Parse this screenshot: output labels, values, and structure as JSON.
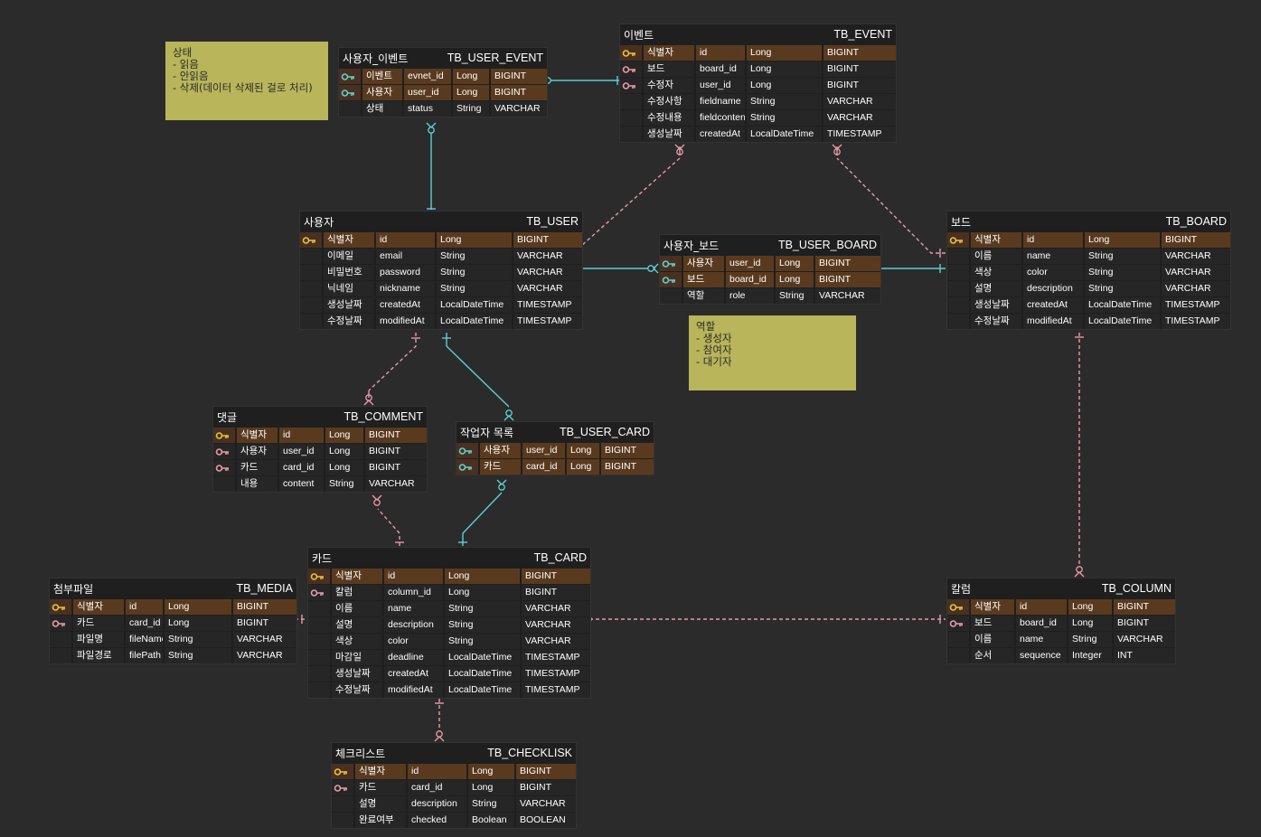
{
  "notes": {
    "status": [
      "상태",
      "- 읽음",
      "- 안읽음",
      "- 삭제(데이터 삭제된 걸로 처리)"
    ],
    "role": [
      "역할",
      "- 생성자",
      "- 참여자",
      "- 대기자"
    ]
  },
  "colors": {
    "pk": "#e8c23a",
    "fk_pink": "#e89aa8",
    "fk_teal": "#5fd0d0",
    "note": "#b8b55a",
    "pk_row": "#5a3a1e"
  },
  "entities": {
    "user_event": {
      "title": "사용자_이벤트",
      "table": "TB_USER_EVENT",
      "rows": [
        {
          "icon": "teal-key",
          "label": "이벤트",
          "name": "evnet_id",
          "java": "Long",
          "sql": "BIGINT",
          "pk": true
        },
        {
          "icon": "teal-key",
          "label": "사용자",
          "name": "user_id",
          "java": "Long",
          "sql": "BIGINT",
          "pk": true
        },
        {
          "icon": "",
          "label": "상태",
          "name": "status",
          "java": "String",
          "sql": "VARCHAR",
          "pk": false
        }
      ]
    },
    "event": {
      "title": "이벤트",
      "table": "TB_EVENT",
      "rows": [
        {
          "icon": "gold-key",
          "label": "식별자",
          "name": "id",
          "java": "Long",
          "sql": "BIGINT",
          "pk": true
        },
        {
          "icon": "pink-key",
          "label": "보드",
          "name": "board_id",
          "java": "Long",
          "sql": "BIGINT",
          "pk": false
        },
        {
          "icon": "pink-key",
          "label": "수정자",
          "name": "user_id",
          "java": "Long",
          "sql": "BIGINT",
          "pk": false
        },
        {
          "icon": "",
          "label": "수정사항",
          "name": "fieldname",
          "java": "String",
          "sql": "VARCHAR",
          "pk": false
        },
        {
          "icon": "",
          "label": "수정내용",
          "name": "fieldcontent",
          "java": "String",
          "sql": "VARCHAR",
          "pk": false
        },
        {
          "icon": "",
          "label": "생성날짜",
          "name": "createdAt",
          "java": "LocalDateTime",
          "sql": "TIMESTAMP",
          "pk": false
        }
      ]
    },
    "user": {
      "title": "사용자",
      "table": "TB_USER",
      "rows": [
        {
          "icon": "gold-key",
          "label": "식별자",
          "name": "id",
          "java": "Long",
          "sql": "BIGINT",
          "pk": true
        },
        {
          "icon": "",
          "label": "이메일",
          "name": "email",
          "java": "String",
          "sql": "VARCHAR",
          "pk": false
        },
        {
          "icon": "",
          "label": "비밀번호",
          "name": "password",
          "java": "String",
          "sql": "VARCHAR",
          "pk": false
        },
        {
          "icon": "",
          "label": "닉네임",
          "name": "nickname",
          "java": "String",
          "sql": "VARCHAR",
          "pk": false
        },
        {
          "icon": "",
          "label": "생성날짜",
          "name": "createdAt",
          "java": "LocalDateTime",
          "sql": "TIMESTAMP",
          "pk": false
        },
        {
          "icon": "",
          "label": "수정날짜",
          "name": "modifiedAt",
          "java": "LocalDateTime",
          "sql": "TIMESTAMP",
          "pk": false
        }
      ]
    },
    "user_board": {
      "title": "사용자_보드",
      "table": "TB_USER_BOARD",
      "rows": [
        {
          "icon": "teal-key",
          "label": "사용자",
          "name": "user_id",
          "java": "Long",
          "sql": "BIGINT",
          "pk": true
        },
        {
          "icon": "teal-key",
          "label": "보드",
          "name": "board_id",
          "java": "Long",
          "sql": "BIGINT",
          "pk": true
        },
        {
          "icon": "",
          "label": "역할",
          "name": "role",
          "java": "String",
          "sql": "VARCHAR",
          "pk": false
        }
      ]
    },
    "board": {
      "title": "보드",
      "table": "TB_BOARD",
      "rows": [
        {
          "icon": "gold-key",
          "label": "식별자",
          "name": "id",
          "java": "Long",
          "sql": "BIGINT",
          "pk": true
        },
        {
          "icon": "",
          "label": "이름",
          "name": "name",
          "java": "String",
          "sql": "VARCHAR",
          "pk": false
        },
        {
          "icon": "",
          "label": "색상",
          "name": "color",
          "java": "String",
          "sql": "VARCHAR",
          "pk": false
        },
        {
          "icon": "",
          "label": "설명",
          "name": "description",
          "java": "String",
          "sql": "VARCHAR",
          "pk": false
        },
        {
          "icon": "",
          "label": "생성날짜",
          "name": "createdAt",
          "java": "LocalDateTime",
          "sql": "TIMESTAMP",
          "pk": false
        },
        {
          "icon": "",
          "label": "수정날짜",
          "name": "modifiedAt",
          "java": "LocalDateTime",
          "sql": "TIMESTAMP",
          "pk": false
        }
      ]
    },
    "comment": {
      "title": "댓글",
      "table": "TB_COMMENT",
      "rows": [
        {
          "icon": "gold-key",
          "label": "식별자",
          "name": "id",
          "java": "Long",
          "sql": "BIGINT",
          "pk": true
        },
        {
          "icon": "pink-key",
          "label": "사용자",
          "name": "user_id",
          "java": "Long",
          "sql": "BIGINT",
          "pk": false
        },
        {
          "icon": "pink-key",
          "label": "카드",
          "name": "card_id",
          "java": "Long",
          "sql": "BIGINT",
          "pk": false
        },
        {
          "icon": "",
          "label": "내용",
          "name": "content",
          "java": "String",
          "sql": "VARCHAR",
          "pk": false
        }
      ]
    },
    "user_card": {
      "title": "작업자 목록",
      "table": "TB_USER_CARD",
      "rows": [
        {
          "icon": "teal-key",
          "label": "사용자",
          "name": "user_id",
          "java": "Long",
          "sql": "BIGINT",
          "pk": true
        },
        {
          "icon": "teal-key",
          "label": "카드",
          "name": "card_id",
          "java": "Long",
          "sql": "BIGINT",
          "pk": true
        }
      ]
    },
    "card": {
      "title": "카드",
      "table": "TB_CARD",
      "rows": [
        {
          "icon": "gold-key",
          "label": "식별자",
          "name": "id",
          "java": "Long",
          "sql": "BIGINT",
          "pk": true
        },
        {
          "icon": "pink-key",
          "label": "칼럼",
          "name": "column_id",
          "java": "Long",
          "sql": "BIGINT",
          "pk": false
        },
        {
          "icon": "",
          "label": "이름",
          "name": "name",
          "java": "String",
          "sql": "VARCHAR",
          "pk": false
        },
        {
          "icon": "",
          "label": "설명",
          "name": "description",
          "java": "String",
          "sql": "VARCHAR",
          "pk": false
        },
        {
          "icon": "",
          "label": "색상",
          "name": "color",
          "java": "String",
          "sql": "VARCHAR",
          "pk": false
        },
        {
          "icon": "",
          "label": "마감일",
          "name": "deadline",
          "java": "LocalDateTime",
          "sql": "TIMESTAMP",
          "pk": false
        },
        {
          "icon": "",
          "label": "생성날짜",
          "name": "createdAt",
          "java": "LocalDateTime",
          "sql": "TIMESTAMP",
          "pk": false
        },
        {
          "icon": "",
          "label": "수정날짜",
          "name": "modifiedAt",
          "java": "LocalDateTime",
          "sql": "TIMESTAMP",
          "pk": false
        }
      ]
    },
    "media": {
      "title": "첨부파일",
      "table": "TB_MEDIA",
      "rows": [
        {
          "icon": "gold-key",
          "label": "식별자",
          "name": "id",
          "java": "Long",
          "sql": "BIGINT",
          "pk": true
        },
        {
          "icon": "pink-key",
          "label": "카드",
          "name": "card_id",
          "java": "Long",
          "sql": "BIGINT",
          "pk": false
        },
        {
          "icon": "",
          "label": "파일명",
          "name": "fileName",
          "java": "String",
          "sql": "VARCHAR",
          "pk": false
        },
        {
          "icon": "",
          "label": "파일경로",
          "name": "filePath",
          "java": "String",
          "sql": "VARCHAR",
          "pk": false
        }
      ]
    },
    "column": {
      "title": "칼럼",
      "table": "TB_COLUMN",
      "rows": [
        {
          "icon": "gold-key",
          "label": "식별자",
          "name": "id",
          "java": "Long",
          "sql": "BIGINT",
          "pk": true
        },
        {
          "icon": "pink-key",
          "label": "보드",
          "name": "board_id",
          "java": "Long",
          "sql": "BIGINT",
          "pk": false
        },
        {
          "icon": "",
          "label": "이름",
          "name": "name",
          "java": "String",
          "sql": "VARCHAR",
          "pk": false
        },
        {
          "icon": "",
          "label": "순서",
          "name": "sequence",
          "java": "Integer",
          "sql": "INT",
          "pk": false
        }
      ]
    },
    "checklist": {
      "title": "체크리스트",
      "table": "TB_CHECKLISK",
      "rows": [
        {
          "icon": "gold-key",
          "label": "식별자",
          "name": "id",
          "java": "Long",
          "sql": "BIGINT",
          "pk": true
        },
        {
          "icon": "pink-key",
          "label": "카드",
          "name": "card_id",
          "java": "Long",
          "sql": "BIGINT",
          "pk": false
        },
        {
          "icon": "",
          "label": "설명",
          "name": "description",
          "java": "String",
          "sql": "VARCHAR",
          "pk": false
        },
        {
          "icon": "",
          "label": "완료여부",
          "name": "checked",
          "java": "Boolean",
          "sql": "BOOLEAN",
          "pk": false
        }
      ]
    }
  }
}
